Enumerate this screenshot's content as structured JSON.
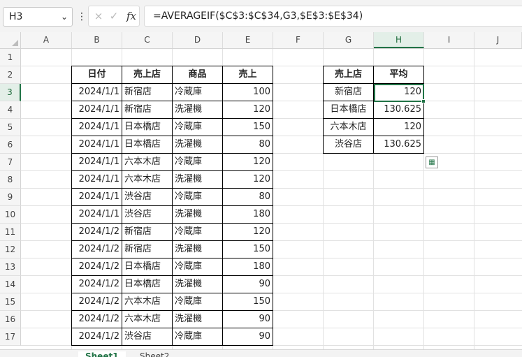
{
  "formula_bar": {
    "name_box": "H3",
    "formula": "=AVERAGEIF($C$3:$C$34,G3,$E$3:$E$34)",
    "cancel_icon": "×",
    "enter_icon": "✓",
    "fx_label": "fx",
    "kebab_icon": "⋮",
    "dropdown_icon": "⌄"
  },
  "columns": [
    "A",
    "B",
    "C",
    "D",
    "E",
    "F",
    "G",
    "H",
    "I",
    "J"
  ],
  "rows": [
    "1",
    "2",
    "3",
    "4",
    "5",
    "6",
    "7",
    "8",
    "9",
    "10",
    "11",
    "12",
    "13",
    "14",
    "15",
    "16",
    "17"
  ],
  "sales_table": {
    "headers": [
      "日付",
      "売上店",
      "商品",
      "売上"
    ],
    "rows": [
      [
        "2024/1/1",
        "新宿店",
        "冷蔵庫",
        "100"
      ],
      [
        "2024/1/1",
        "新宿店",
        "洗濯機",
        "120"
      ],
      [
        "2024/1/1",
        "日本橋店",
        "冷蔵庫",
        "150"
      ],
      [
        "2024/1/1",
        "日本橋店",
        "洗濯機",
        "80"
      ],
      [
        "2024/1/1",
        "六本木店",
        "冷蔵庫",
        "120"
      ],
      [
        "2024/1/1",
        "六本木店",
        "洗濯機",
        "120"
      ],
      [
        "2024/1/1",
        "渋谷店",
        "冷蔵庫",
        "80"
      ],
      [
        "2024/1/1",
        "渋谷店",
        "洗濯機",
        "180"
      ],
      [
        "2024/1/2",
        "新宿店",
        "冷蔵庫",
        "120"
      ],
      [
        "2024/1/2",
        "新宿店",
        "洗濯機",
        "150"
      ],
      [
        "2024/1/2",
        "日本橋店",
        "冷蔵庫",
        "180"
      ],
      [
        "2024/1/2",
        "日本橋店",
        "洗濯機",
        "90"
      ],
      [
        "2024/1/2",
        "六本木店",
        "冷蔵庫",
        "150"
      ],
      [
        "2024/1/2",
        "六本木店",
        "洗濯機",
        "90"
      ],
      [
        "2024/1/2",
        "渋谷店",
        "冷蔵庫",
        "90"
      ]
    ]
  },
  "average_table": {
    "headers": [
      "売上店",
      "平均"
    ],
    "rows": [
      [
        "新宿店",
        "120"
      ],
      [
        "日本橋店",
        "130.625"
      ],
      [
        "六本木店",
        "120"
      ],
      [
        "渋谷店",
        "130.625"
      ]
    ]
  },
  "sheet_tabs": [
    "Sheet1",
    "Sheet2"
  ],
  "active_cell": "H3",
  "colors": {
    "accent": "#217346",
    "grid": "#e1e1e1",
    "header_bg": "#f5f5f5"
  }
}
